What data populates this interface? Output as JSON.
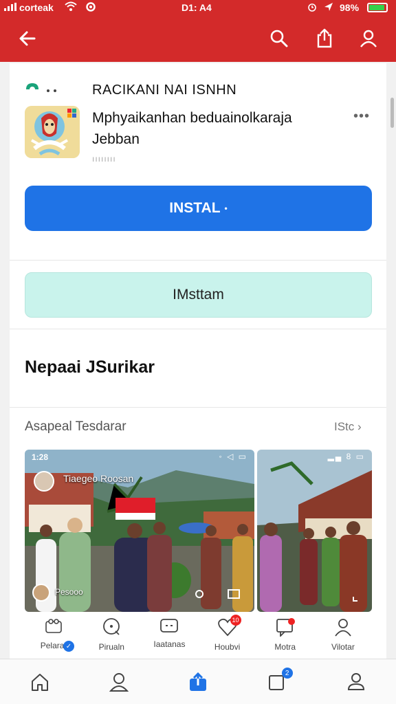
{
  "status_bar": {
    "carrier": "corteak",
    "time": "D1: A4",
    "battery": "98%",
    "battery_level": 0.9,
    "battery_color": "#37d04a"
  },
  "app_bar": {
    "color": "#d32a2a",
    "icons": [
      "back-arrow-icon",
      "search-icon",
      "share-icon",
      "profile-icon"
    ]
  },
  "app": {
    "header_title": "RACIKANI NAI ISNHN",
    "name": "Mphyaikanhan beduainolkaraja Jebban",
    "meta": "ıııııııı",
    "more": "•••"
  },
  "buttons": {
    "install": "INSTAL",
    "install_dot": "•",
    "secondary": "IMsttam"
  },
  "section_title": "Nepaai JSurikar",
  "screenshots": {
    "label": "Asapeal Tesdarar",
    "link": "IStc ›",
    "items": [
      {
        "time": "1:28",
        "status": "◦ ◁ ▭",
        "name": "Tiaegeo Roosan",
        "name2": "Pesooo"
      },
      {
        "status": "▂▄ 8 ▭"
      }
    ]
  },
  "action_tabs": [
    {
      "label": "Pelarar",
      "icon": "community-icon"
    },
    {
      "label": "Pirualn",
      "icon": "chat-icon"
    },
    {
      "label": "Iaatanas",
      "icon": "message-icon"
    },
    {
      "label": "Houbvi",
      "icon": "heart-icon",
      "badge": "10"
    },
    {
      "label": "Motra",
      "icon": "comment-icon"
    },
    {
      "label": "Vilotar",
      "icon": "user-icon"
    }
  ],
  "bottom_nav": {
    "items": [
      "home-icon",
      "profile-icon",
      "upload-icon",
      "notes-icon",
      "account-icon"
    ],
    "badge": "2"
  },
  "colors": {
    "brand": "#d32a2a",
    "primary": "#1f73e6",
    "secondary": "#c9f3ec"
  }
}
